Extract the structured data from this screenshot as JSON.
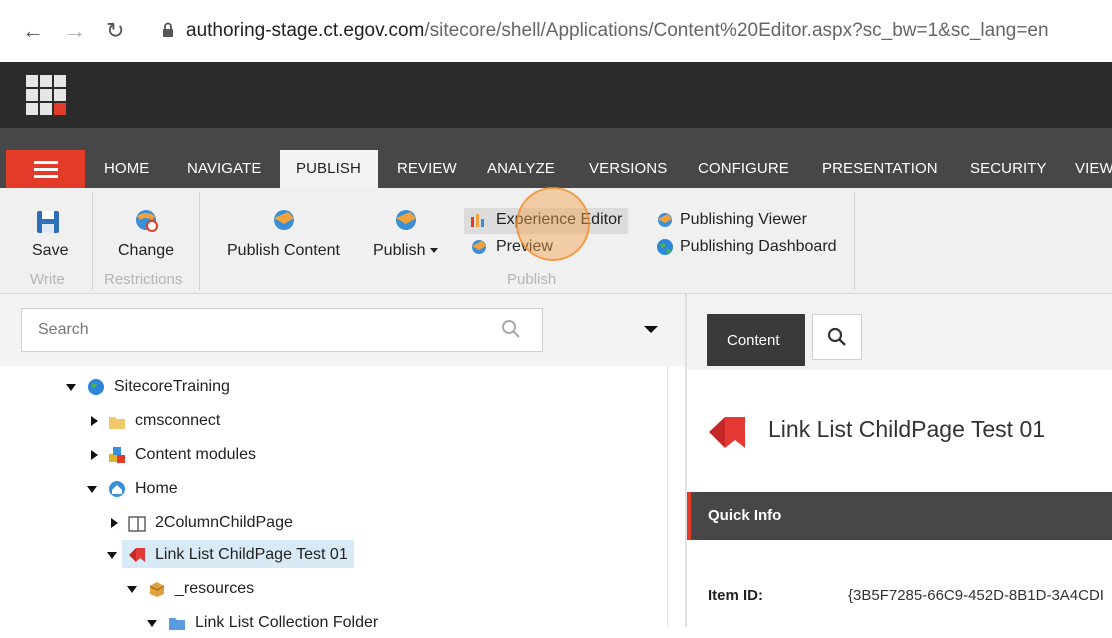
{
  "browser": {
    "url_host": "authoring-stage.ct.egov.com",
    "url_path": "/sitecore/shell/Applications/Content%20Editor.aspx?sc_bw=1&sc_lang=en"
  },
  "ribbon_tabs": {
    "home": "HOME",
    "navigate": "NAVIGATE",
    "publish": "PUBLISH",
    "review": "REVIEW",
    "analyze": "ANALYZE",
    "versions": "VERSIONS",
    "configure": "CONFIGURE",
    "presentation": "PRESENTATION",
    "security": "SECURITY",
    "view": "VIEW"
  },
  "ribbon": {
    "save": "Save",
    "write_group": "Write",
    "change": "Change",
    "restrictions_group": "Restrictions",
    "publish_content": "Publish Content",
    "publish": "Publish",
    "experience_editor": "Experience Editor",
    "preview": "Preview",
    "publishing_viewer": "Publishing Viewer",
    "publishing_dashboard": "Publishing Dashboard",
    "publish_group": "Publish"
  },
  "search": {
    "placeholder": "Search"
  },
  "tree": {
    "sitecore_training": "SitecoreTraining",
    "cmsconnect": "cmsconnect",
    "content_modules": "Content modules",
    "home": "Home",
    "two_column": "2ColumnChildPage",
    "link_list": "Link List ChildPage Test 01",
    "resources": "_resources",
    "link_list_folder": "Link List Collection Folder"
  },
  "editor": {
    "content_tab": "Content",
    "item_title": "Link List ChildPage Test 01",
    "quick_info": "Quick Info",
    "item_id_label": "Item ID:",
    "item_id_value": "{3B5F7285-66C9-452D-8B1D-3A4CDI"
  },
  "colors": {
    "accent_red": "#e23b2a",
    "ribbon_dark": "#474747",
    "topbar": "#2b2b2b",
    "selection": "#d9eaf7"
  }
}
